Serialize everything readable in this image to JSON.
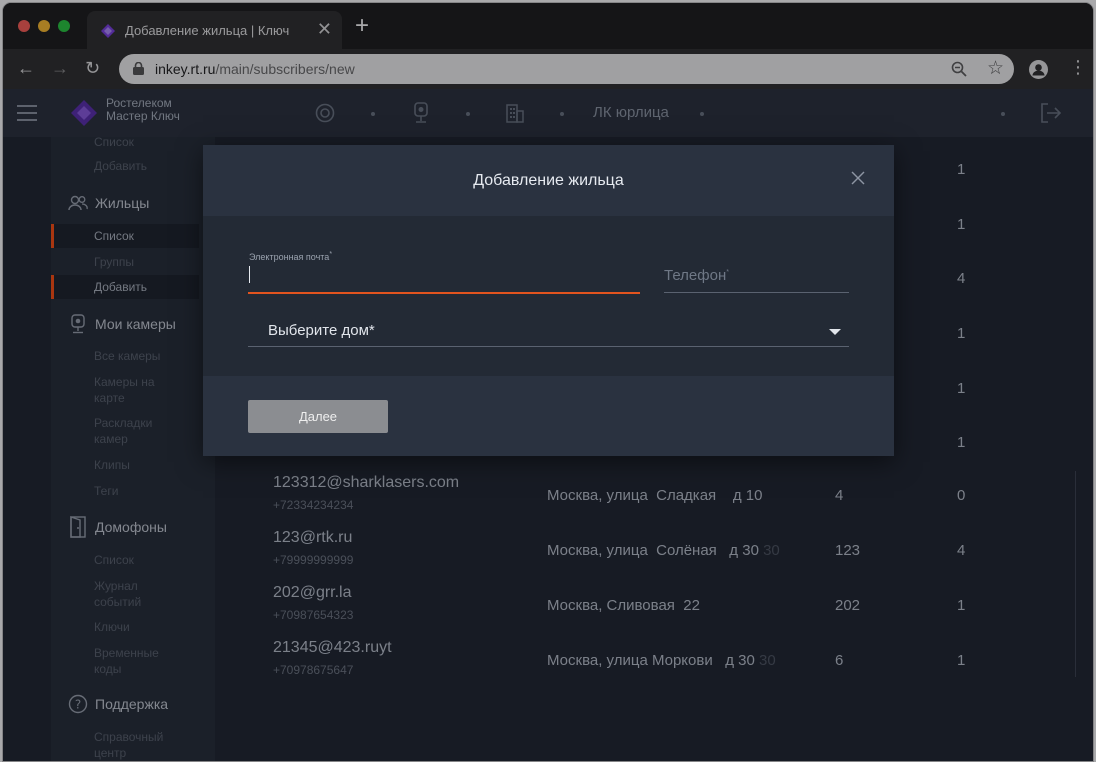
{
  "browser": {
    "tab_title": "Добавление жильца | Ключ",
    "url_host": "inkey.rt.ru",
    "url_path": "/main/subscribers/new",
    "new_tab_icon": "plus-icon",
    "close_tab_glyph": "✕"
  },
  "header": {
    "logo_line1": "Ростелеком",
    "logo_line2": "Мастер Ключ",
    "lk_label": "ЛК юрлица"
  },
  "sidebar": {
    "top_items": [
      "Список",
      "Добавить"
    ],
    "residents": {
      "title": "Жильцы",
      "items": [
        "Список",
        "Группы",
        "Добавить"
      ]
    },
    "cameras": {
      "title": "Мои камеры",
      "items": [
        "Все камеры",
        "Камеры на карте",
        "Раскладки камер",
        "Клипы",
        "Теги"
      ]
    },
    "intercoms": {
      "title": "Домофоны",
      "items": [
        "Список",
        "Журнал событий",
        "Ключи",
        "Временные коды"
      ]
    },
    "support": {
      "title": "Поддержка",
      "items": [
        "Справочный центр"
      ]
    }
  },
  "table": {
    "hidden_counts": [
      "1",
      "1",
      "4",
      "1",
      "1",
      "1"
    ],
    "rows": [
      {
        "email": "123312@sharklasers.com",
        "phone": "+72334234234",
        "address": "Москва, улица  Сладкая    д 10",
        "address_extra": "",
        "flat": "4",
        "count": "0"
      },
      {
        "email": "123@rtk.ru",
        "phone": "+79999999999",
        "address": "Москва, улица  Солёная   д 30",
        "address_extra": " 30",
        "flat": "123",
        "count": "4"
      },
      {
        "email": "202@grr.la",
        "phone": "+70987654323",
        "address": "Москва, Сливовая  22",
        "address_extra": "",
        "flat": "202",
        "count": "1"
      },
      {
        "email": "21345@423.ruyt",
        "phone": "+70978675647",
        "address": "Москва, улица Моркови   д 30",
        "address_extra": " 30",
        "flat": "6",
        "count": "1"
      }
    ]
  },
  "modal": {
    "title": "Добавление жильца",
    "email_label": "Электронная почта",
    "email_value": "",
    "phone_placeholder": "Телефон",
    "required_mark": "*",
    "house_select": "Выберите дом*",
    "next_button": "Далее"
  },
  "colors": {
    "accent": "#ff4f12",
    "disabled_button": "#8b8d91"
  }
}
